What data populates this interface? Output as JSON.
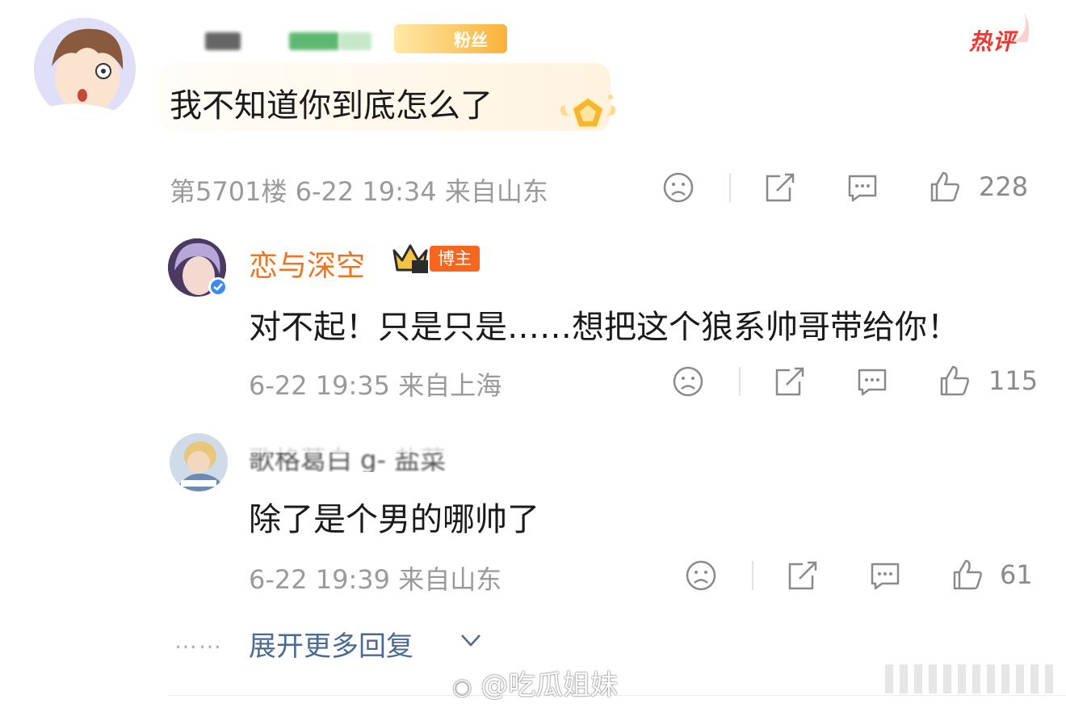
{
  "comment": {
    "text": "我不知道你到底怎么了",
    "fan_badge_label": "粉丝",
    "hot_tag": "热评",
    "floor": "第5701楼",
    "time": "6-22 19:34",
    "location": "来自山东",
    "likes": "228"
  },
  "replies": [
    {
      "author": "恋与深空",
      "role_badge": "博主",
      "text": "对不起！只是只是……想把这个狼系帅哥带给你！",
      "time": "6-22 19:35",
      "location": "来自上海",
      "likes": "115"
    },
    {
      "author": "歌格葛白 g- 盐菜",
      "text": "除了是个男的哪帅了",
      "time": "6-22 19:39",
      "location": "来自山东",
      "likes": "61"
    }
  ],
  "expand_more_label": "展开更多回复",
  "dots": "……",
  "watermark": "@吃瓜姐妹",
  "colors": {
    "accent_orange": "#f0731f",
    "hot_red": "#f0362f",
    "link_blue": "#4a6a94",
    "meta_gray": "#9a9a9a"
  }
}
